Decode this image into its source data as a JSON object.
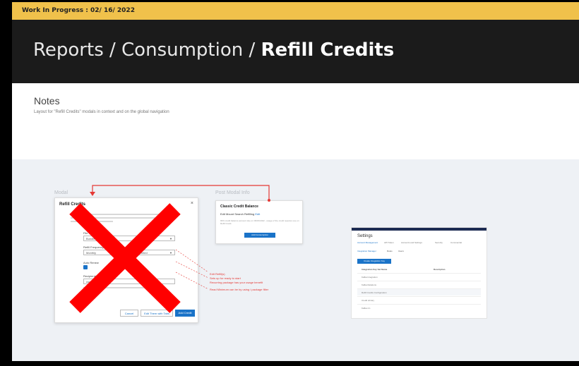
{
  "wip_banner": {
    "text": "Work In Progress : 02/ 16/ 2022"
  },
  "breadcrumb": {
    "part1": "Reports / Consumption / ",
    "current": "Refill Credits"
  },
  "notes": {
    "title": "Notes",
    "description": "Layout for \"Refill Credits\" modals in context and on the global navigation"
  },
  "canvas": {
    "frame_labels": [
      "Modal",
      "Post Modal Info"
    ],
    "modal": {
      "title": "Refill Credits",
      "close": "×",
      "fields": [
        {
          "label": "File Type",
          "value": "Bundle Up"
        },
        {
          "label": "Refill Frequency",
          "value": "Monthly"
        },
        {
          "label": "Amount",
          "value": "Unlimited"
        },
        {
          "label": "Recipients",
          "value": "user@email.com"
        }
      ],
      "checkbox_label": "Auto Renew",
      "buttons": {
        "cancel": "Cancel",
        "secondary": "Edit Them with Tabs",
        "primary": "Add Credit"
      }
    },
    "balance_card": {
      "title": "Classic Credit Balance",
      "line_prefix": "Edit Mount Search Refilling ",
      "line_link": "Edit",
      "small_text": "99% credit balance account due on 09/15/2022 - usage of the credit requires use on Refill Credit",
      "button": "Add Consumption"
    },
    "annotations": [
      "Edit Refill(s)",
      "Sets up for ready to start",
      "Recurring package has your usage benefit",
      "Read Minimum can be by using / package filter"
    ],
    "settings": {
      "title": "Settings",
      "tabs": [
        "Account Management",
        "API Token",
        "Accounts and Settings",
        "Security",
        "Commercial"
      ],
      "subtabs": [
        "Integration Manager",
        "Roles",
        "Users"
      ],
      "button": "Create Integration Key",
      "columns": [
        "Integration Key Set Name",
        "Description"
      ],
      "rows": [
        "Kafka Integration",
        "Kafka Relations",
        "Refill Credits Configuration",
        "Credit Library",
        "Kafka 4.1"
      ]
    }
  },
  "colors": {
    "accent": "#1a73c8",
    "wip": "#f0c14b",
    "cross": "#ff0000",
    "annotation": "#e53935"
  }
}
